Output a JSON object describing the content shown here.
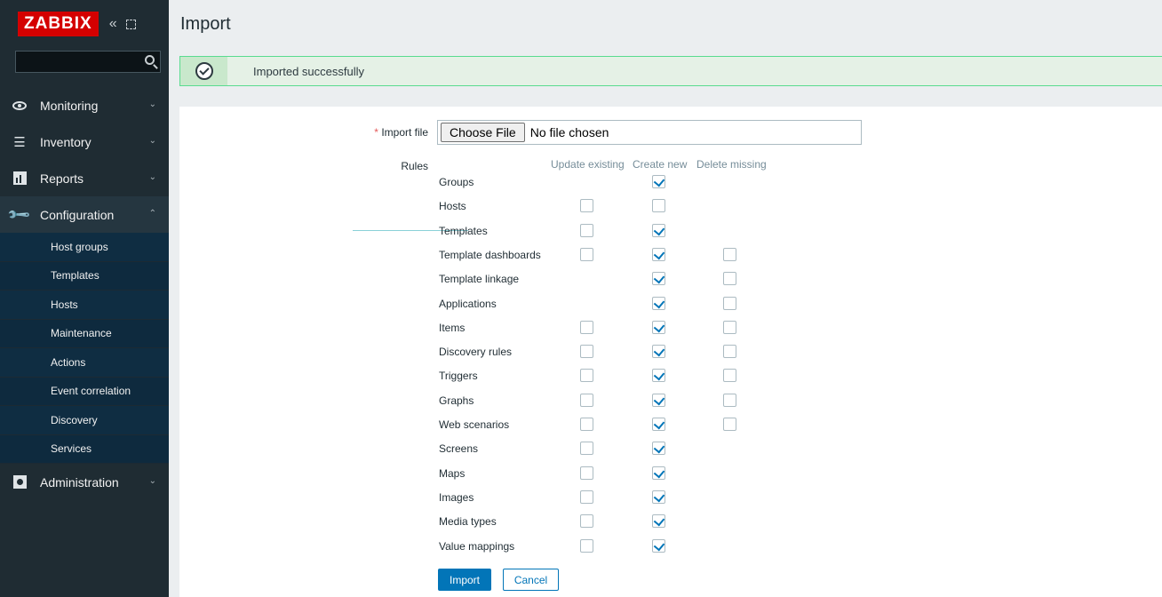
{
  "brand": {
    "logo": "ZABBIX",
    "collapse_glyph": "«"
  },
  "search": {
    "value": "",
    "placeholder": ""
  },
  "sidebar": {
    "menu": [
      {
        "label": "Monitoring",
        "icon": "eye-icon",
        "chevron": "⌄"
      },
      {
        "label": "Inventory",
        "icon": "list-icon",
        "chevron": "⌄"
      },
      {
        "label": "Reports",
        "icon": "report-icon",
        "chevron": "⌄"
      },
      {
        "label": "Configuration",
        "icon": "wrench-icon",
        "chevron": "⌃"
      }
    ],
    "submenu": [
      "Host groups",
      "Templates",
      "Hosts",
      "Maintenance",
      "Actions",
      "Event correlation",
      "Discovery",
      "Services"
    ],
    "administration": {
      "label": "Administration",
      "icon": "gear-icon",
      "chevron": "⌄"
    }
  },
  "page": {
    "title": "Import"
  },
  "message": {
    "text": "Imported successfully",
    "status": "success"
  },
  "form": {
    "import_file_label": "Import file",
    "required_mark": "*",
    "choose_file_label": "Choose File",
    "file_status": "No file chosen",
    "rules_label": "Rules",
    "columns": [
      "Update existing",
      "Create new",
      "Delete missing"
    ],
    "rules": [
      {
        "label": "Groups",
        "update": null,
        "create": true,
        "delete": null
      },
      {
        "label": "Hosts",
        "update": false,
        "create": false,
        "delete": null
      },
      {
        "label": "Templates",
        "update": false,
        "create": true,
        "delete": null
      },
      {
        "label": "Template dashboards",
        "update": false,
        "create": true,
        "delete": false
      },
      {
        "label": "Template linkage",
        "update": null,
        "create": true,
        "delete": false
      },
      {
        "label": "Applications",
        "update": null,
        "create": true,
        "delete": false
      },
      {
        "label": "Items",
        "update": false,
        "create": true,
        "delete": false
      },
      {
        "label": "Discovery rules",
        "update": false,
        "create": true,
        "delete": false
      },
      {
        "label": "Triggers",
        "update": false,
        "create": true,
        "delete": false
      },
      {
        "label": "Graphs",
        "update": false,
        "create": true,
        "delete": false
      },
      {
        "label": "Web scenarios",
        "update": false,
        "create": true,
        "delete": false
      },
      {
        "label": "Screens",
        "update": false,
        "create": true,
        "delete": null
      },
      {
        "label": "Maps",
        "update": false,
        "create": true,
        "delete": null
      },
      {
        "label": "Images",
        "update": false,
        "create": true,
        "delete": null
      },
      {
        "label": "Media types",
        "update": false,
        "create": true,
        "delete": null
      },
      {
        "label": "Value mappings",
        "update": false,
        "create": true,
        "delete": null
      }
    ],
    "import_button": "Import",
    "cancel_button": "Cancel"
  },
  "colors": {
    "brand": "#d40000",
    "sidebar": "#1f2c33",
    "accent": "#0275b8",
    "success_border": "#59db8f"
  }
}
